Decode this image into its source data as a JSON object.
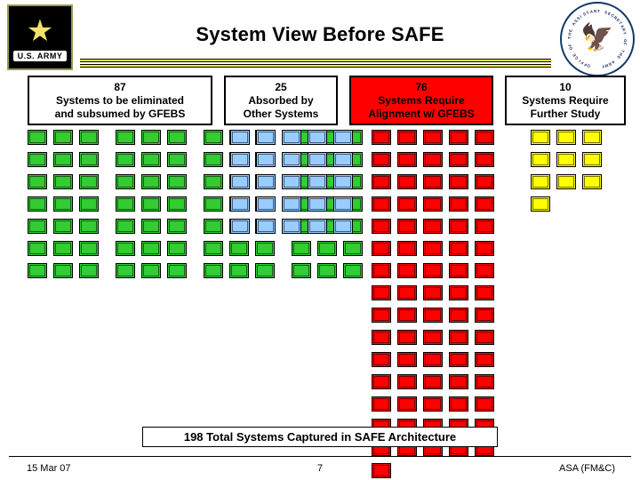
{
  "header": {
    "title": "System View Before SAFE",
    "army_seal": {
      "name": "us-army-seal",
      "label": "U.S. ARMY"
    },
    "asa_seal": {
      "name": "assistant-secretary-of-the-army-seal",
      "ring_text": "OFFICE OF THE ASSISTANT SECRETARY OF THE ARMY"
    }
  },
  "categories": [
    {
      "id": "eliminated",
      "count": "87",
      "line1": "Systems to be eliminated",
      "line2": "and subsumed by GFEBS",
      "box_color": "#ffffff",
      "icon_color": "#33cc33",
      "icons": 87
    },
    {
      "id": "absorbed",
      "count": "25",
      "line1": "Absorbed by",
      "line2": "Other Systems",
      "box_color": "#ffffff",
      "icon_color": "#99ccff",
      "icons": 25
    },
    {
      "id": "alignment",
      "count": "76",
      "line1": "Systems Require",
      "line2": "Alignment w/ GFEBS",
      "box_color": "#ff0000",
      "icon_color": "#ff0000",
      "icons": 76
    },
    {
      "id": "further-study",
      "count": "10",
      "line1": "Systems Require",
      "line2": "Further Study",
      "box_color": "#ffffff",
      "icon_color": "#ffff00",
      "icons": 10
    }
  ],
  "total_banner": "198 Total Systems Captured in SAFE Architecture",
  "footer": {
    "date": "15 Mar 07",
    "page": "7",
    "org": "ASA (FM&C)"
  }
}
